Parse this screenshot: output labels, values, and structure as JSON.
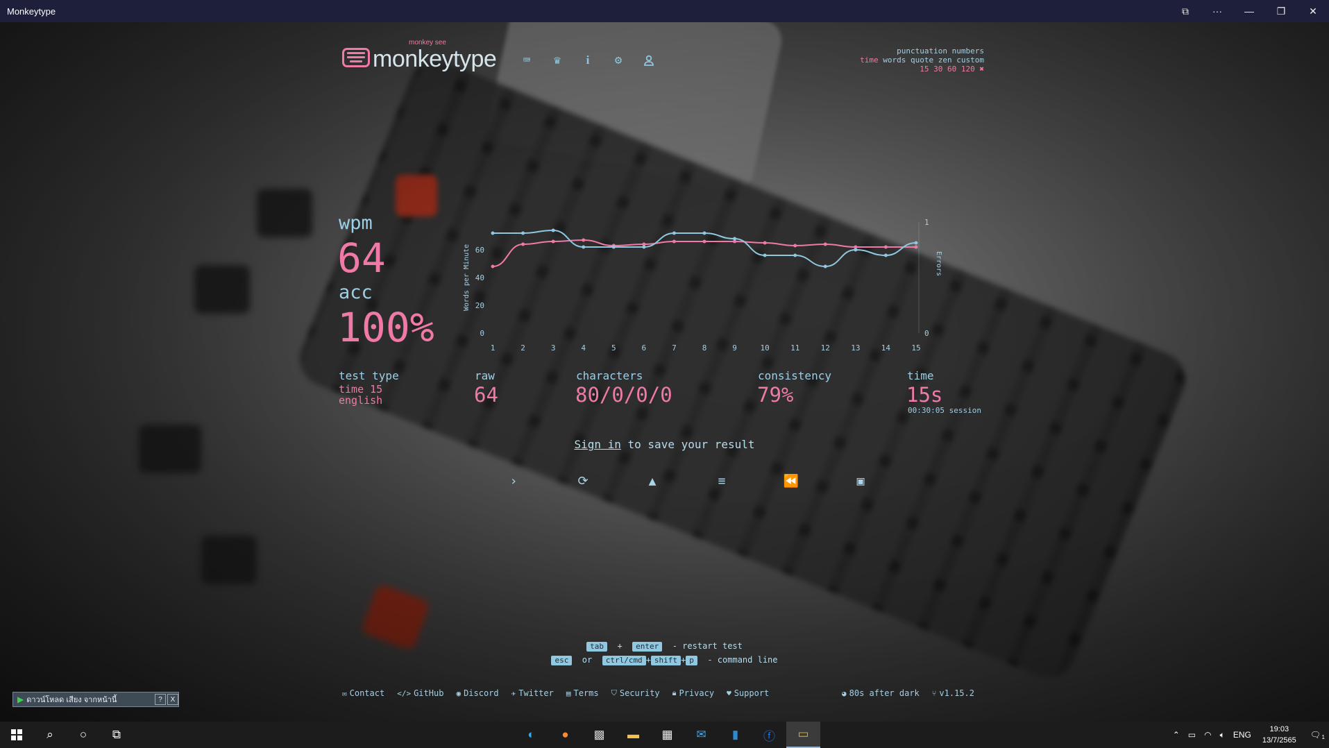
{
  "window": {
    "title": "Monkeytype"
  },
  "header": {
    "tagline": "monkey see",
    "brand": "monkeytype",
    "nav_icons": [
      "keyboard-icon",
      "crown-icon",
      "info-icon",
      "gear-icon",
      "user-icon"
    ]
  },
  "config": {
    "row1": "punctuation numbers",
    "row2_active": "time",
    "row2_rest": "words quote zen custom",
    "row3_durations": "15 30 60 120",
    "row3_icon": "tools-icon"
  },
  "results": {
    "wpm_label": "wpm",
    "wpm_value": "64",
    "acc_label": "acc",
    "acc_value": "100%",
    "test_type_label": "test type",
    "test_type_line1": "time 15",
    "test_type_line2": "english",
    "raw_label": "raw",
    "raw_value": "64",
    "characters_label": "characters",
    "characters_value": "80/0/0/0",
    "consistency_label": "consistency",
    "consistency_value": "79%",
    "time_label": "time",
    "time_value": "15s",
    "session_value": "00:30:05 session"
  },
  "save_prompt": {
    "link": "Sign in",
    "rest": " to save your result"
  },
  "chart_data": {
    "type": "line",
    "x": [
      1,
      2,
      3,
      4,
      5,
      6,
      7,
      8,
      9,
      10,
      11,
      12,
      13,
      14,
      15
    ],
    "ylabel": "Words per Minute",
    "y2label": "Errors",
    "ylim": [
      0,
      80
    ],
    "y2lim": [
      0,
      1
    ],
    "yticks": [
      0,
      20,
      40,
      60
    ],
    "y2ticks": [
      0,
      1
    ],
    "series": [
      {
        "values": [
          48,
          64,
          66,
          67,
          63,
          64,
          66,
          66,
          66,
          65,
          63,
          64,
          62,
          62,
          62
        ],
        "color": "#f07aa7"
      },
      {
        "values": [
          72,
          72,
          74,
          62,
          62,
          62,
          72,
          72,
          68,
          56,
          56,
          48,
          60,
          56,
          65
        ],
        "color": "#8fc8e0"
      }
    ]
  },
  "actions": [
    "next-test-icon",
    "restart-icon",
    "warning-icon",
    "words-history-icon",
    "replay-icon",
    "screenshot-icon"
  ],
  "hints": {
    "k_tab": "tab",
    "plus1": "+",
    "k_enter": "enter",
    "restart_text": "- restart test",
    "k_esc": "esc",
    "or": "or",
    "k_ctrl": "ctrl/cmd",
    "plus2": "+",
    "k_shift": "shift",
    "plus3": "+",
    "k_p": "p",
    "command_text": "- command line"
  },
  "footer": {
    "links": [
      "Contact",
      "GitHub",
      "Discord",
      "Twitter",
      "Terms",
      "Security",
      "Privacy",
      "Support"
    ],
    "theme": "80s after dark",
    "version": "v1.15.2"
  },
  "download_widget": {
    "label": "ดาวน์โหลด เสียง จากหน้านี้",
    "help": "?",
    "close": "X"
  },
  "taskbar": {
    "lang": "ENG",
    "time": "19:03",
    "date": "13/7/2565",
    "notifications": "1"
  },
  "colors": {
    "accent": "#f07aa7",
    "secondary": "#8fc8e0",
    "titlebar": "#1d1f3b"
  }
}
